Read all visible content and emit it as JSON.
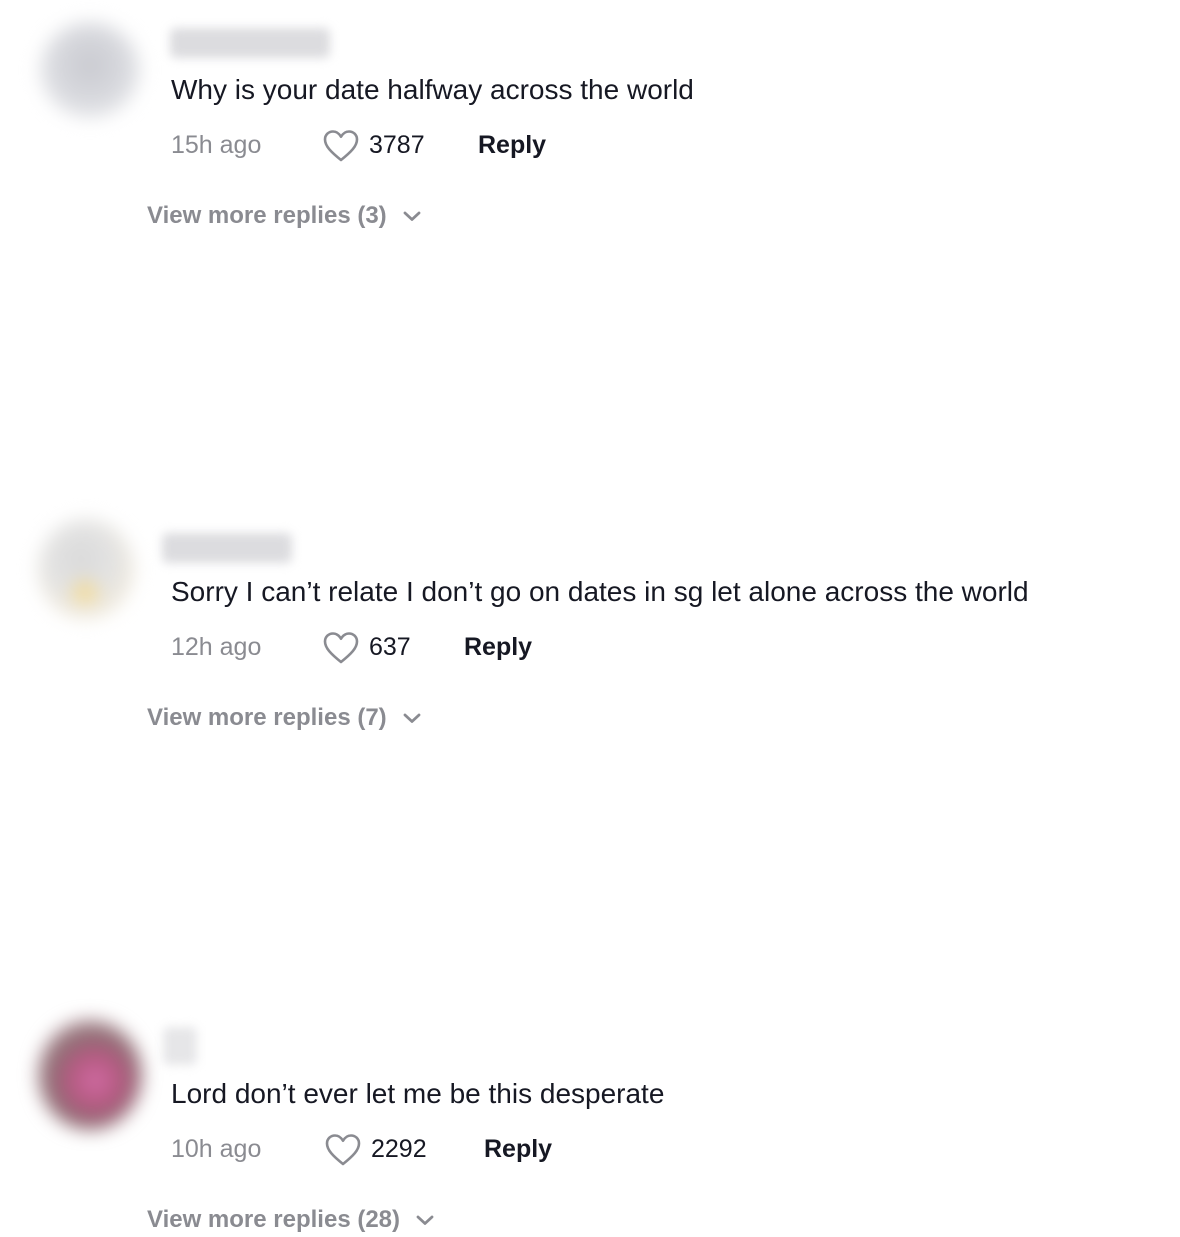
{
  "comments": [
    {
      "text": "Why is your date halfway across the world",
      "time": "15h ago",
      "likes": "3787",
      "reply_label": "Reply",
      "view_more_label": "View more replies (3)"
    },
    {
      "text": "Sorry I can’t relate I don’t go on dates in sg let alone across the world",
      "time": "12h ago",
      "likes": "637",
      "reply_label": "Reply",
      "view_more_label": "View more replies (7)"
    },
    {
      "text": "Lord don’t ever let me be this desperate",
      "time": "10h ago",
      "likes": "2292",
      "reply_label": "Reply",
      "view_more_label": "View more replies (28)"
    }
  ],
  "icons": {
    "like": "heart-outline-icon",
    "expand": "chevron-down-icon"
  },
  "colors": {
    "text": "#161823",
    "secondary": "#8a8b91"
  }
}
